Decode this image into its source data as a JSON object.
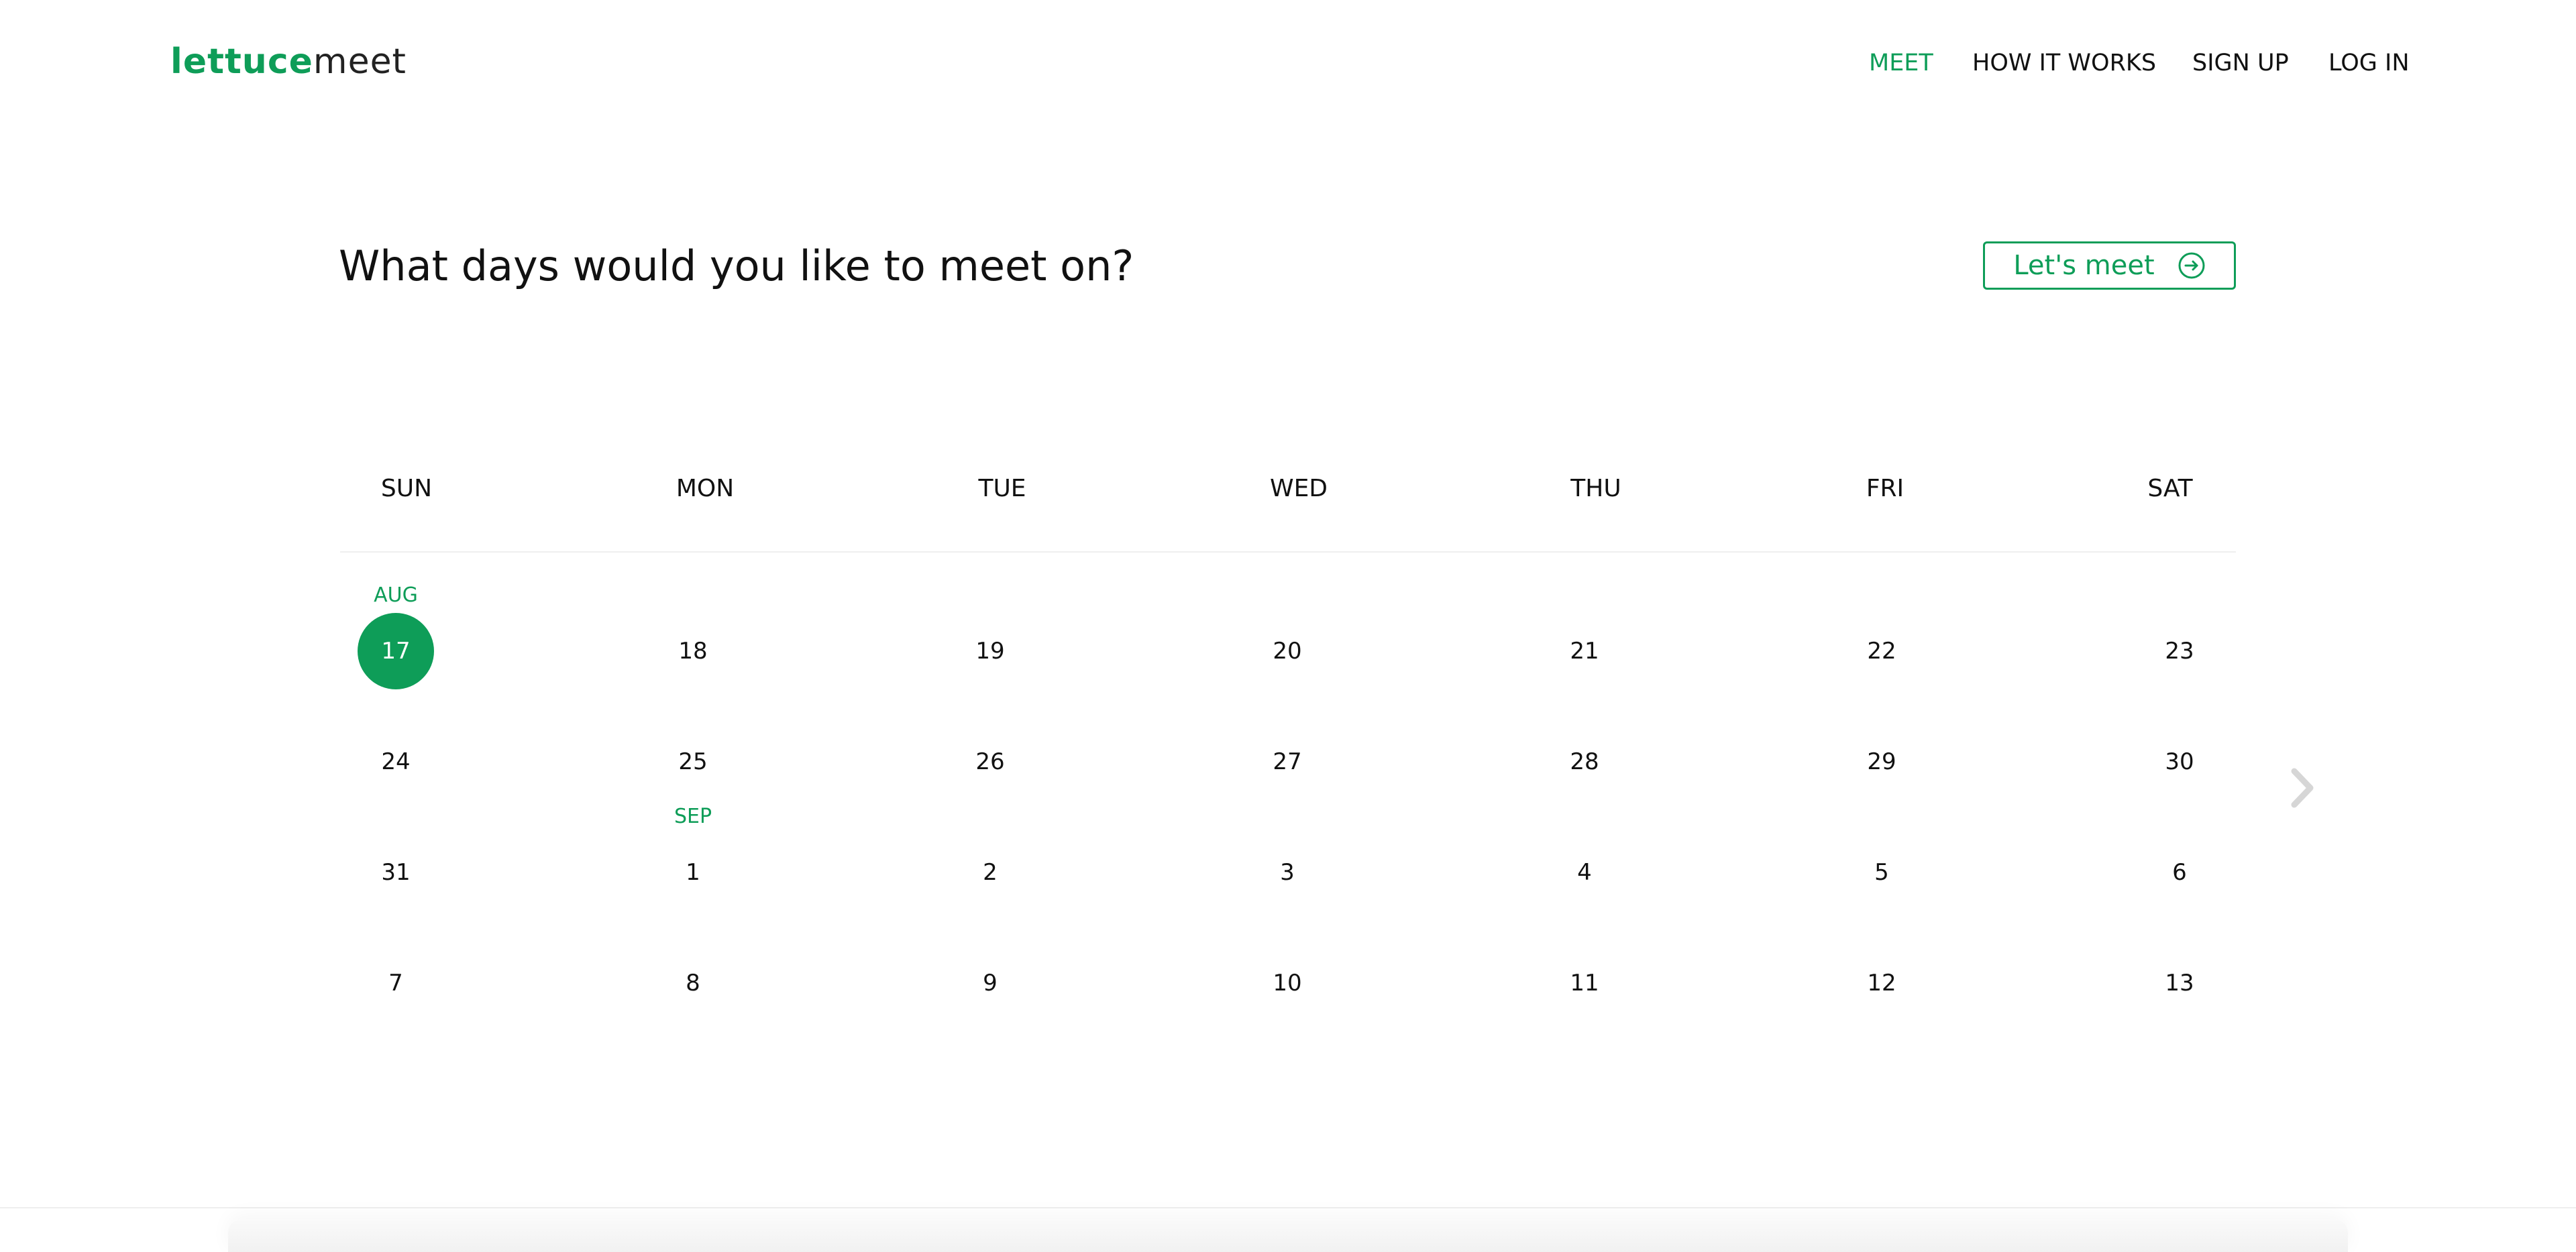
{
  "header": {
    "logo": {
      "part1": "lettuce",
      "part2": "meet"
    },
    "nav": [
      "MEET",
      "HOW IT WORKS",
      "SIGN UP",
      "LOG IN"
    ]
  },
  "main": {
    "title": "What days would you like to meet on?",
    "cta_label": "Let's meet"
  },
  "calendar": {
    "weekdays": [
      "SUN",
      "MON",
      "TUE",
      "WED",
      "THU",
      "FRI",
      "SAT"
    ],
    "month_labels": {
      "aug": "AUG",
      "sep": "SEP"
    },
    "weeks": [
      [
        "17",
        "18",
        "19",
        "20",
        "21",
        "22",
        "23"
      ],
      [
        "24",
        "25",
        "26",
        "27",
        "28",
        "29",
        "30"
      ],
      [
        "31",
        "1",
        "2",
        "3",
        "4",
        "5",
        "6"
      ],
      [
        "7",
        "8",
        "9",
        "10",
        "11",
        "12",
        "13"
      ]
    ],
    "selected_day": "17",
    "accent_color": "#0e9d58"
  }
}
